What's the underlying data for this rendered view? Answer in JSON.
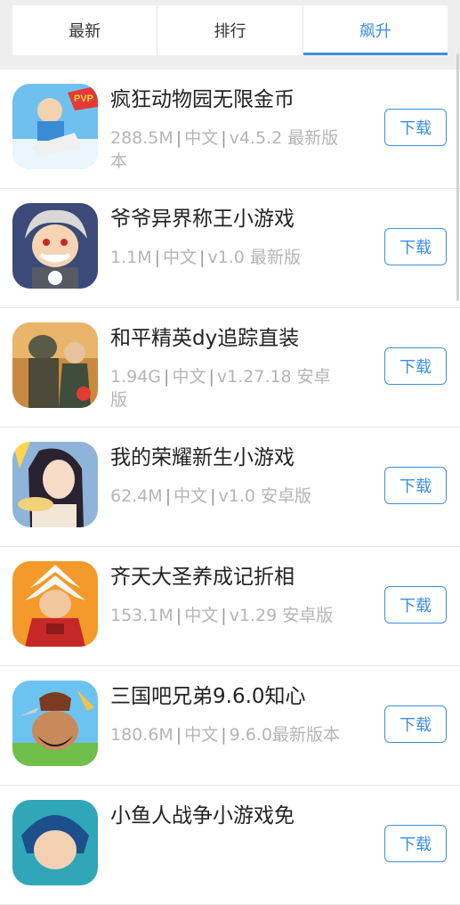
{
  "tabs": [
    {
      "label": "最新",
      "active": false
    },
    {
      "label": "排行",
      "active": false
    },
    {
      "label": "飙升",
      "active": true
    }
  ],
  "download_label": "下载",
  "apps": [
    {
      "name": "疯狂动物园无限金币",
      "meta_size": "288.5M",
      "meta_lang": "中文",
      "meta_version": "v4.5.2 最新版本",
      "icon": "zoo-game-icon"
    },
    {
      "name": "爷爷异界称王小游戏",
      "meta_size": "1.1M",
      "meta_lang": "中文",
      "meta_version": "v1.0 最新版",
      "icon": "grandpa-game-icon"
    },
    {
      "name": "和平精英dy追踪直装",
      "meta_size": "1.94G",
      "meta_lang": "中文",
      "meta_version": "v1.27.18 安卓版",
      "icon": "peace-elite-icon"
    },
    {
      "name": "我的荣耀新生小游戏",
      "meta_size": "62.4M",
      "meta_lang": "中文",
      "meta_version": "v1.0 安卓版",
      "icon": "glory-game-icon"
    },
    {
      "name": "齐天大圣养成记折相",
      "meta_size": "153.1M",
      "meta_lang": "中文",
      "meta_version": "v1.29 安卓版",
      "icon": "monkey-king-icon"
    },
    {
      "name": "三国吧兄弟9.6.0知心",
      "meta_size": "180.6M",
      "meta_lang": "中文",
      "meta_version": "9.6.0最新版本",
      "icon": "three-kingdoms-icon"
    },
    {
      "name": "小鱼人战争小游戏免",
      "meta_size": "",
      "meta_lang": "",
      "meta_version": "",
      "icon": "fishman-game-icon"
    }
  ],
  "colors": {
    "accent": "#3d8fe0",
    "meta_text": "#b5b5b5"
  }
}
